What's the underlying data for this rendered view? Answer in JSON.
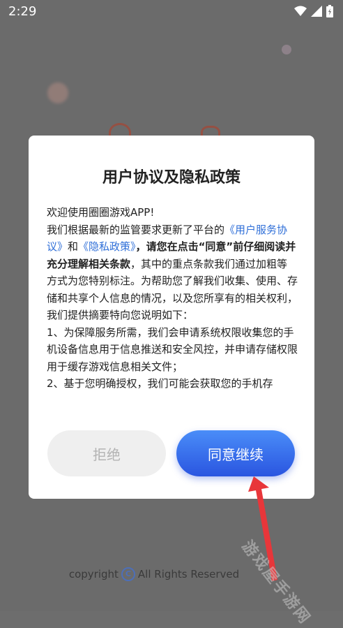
{
  "status_bar": {
    "time": "2:29"
  },
  "dialog": {
    "title": "用户协议及隐私政策",
    "body": {
      "p1": "欢迎使用圈圈游戏APP!",
      "p2_pre": "我们根据最新的监管要求更新了平台的",
      "link_user_agreement": "《用户服务协议》",
      "and": "和",
      "link_privacy_policy": "《隐私政策》",
      "comma": "，",
      "strong_text": "请您在点击“同意”前仔细阅读并充分理解相关条款",
      "p2_post": "，其中的重点条款我们通过加粗等方式为您特别标注。为帮助您了解我们收集、使用、存储和共享个人信息的情况，以及您所享有的相关权利，我们提供摘要特向您说明如下：",
      "item1": "1、为保障服务所需，我们会申请系统权限收集您的手机设备信息用于信息推送和安全风控，并申请存储权限用于缓存游戏信息相关文件；",
      "item2": "2、基于您明确授权，我们可能会获取您的手机存"
    },
    "refuse_button": "拒绝",
    "agree_button": "同意继续"
  },
  "footer": {
    "copyright_pre": "copyright",
    "copyright_post": "All Rights Reserved",
    "c_symbol": "C"
  },
  "watermark": "游戏屋手游网",
  "colors": {
    "link": "#2f6fd8",
    "agree_gradient_top": "#4a8df8",
    "agree_gradient_bottom": "#2a55e0",
    "arrow": "#e8363a"
  }
}
